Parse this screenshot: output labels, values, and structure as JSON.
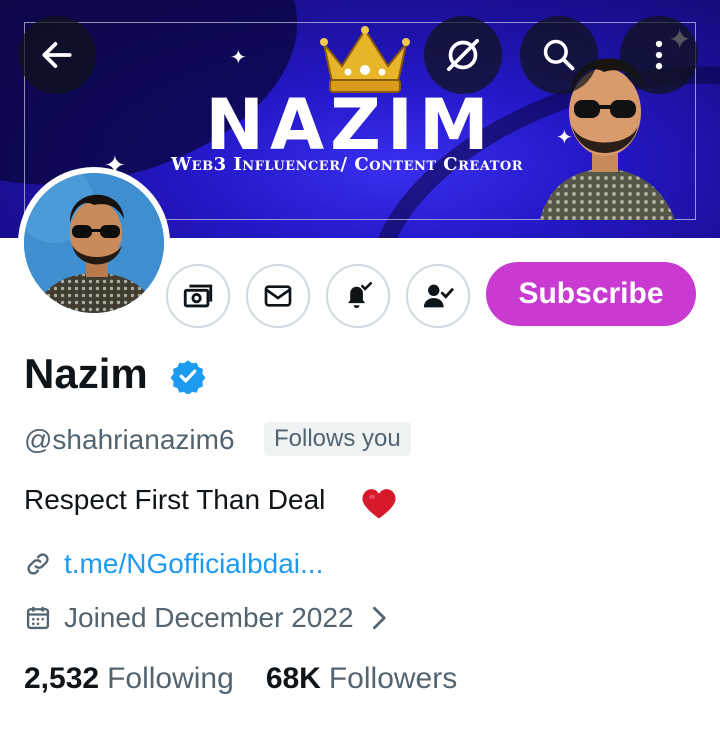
{
  "banner": {
    "title": "NAZIM",
    "subtitle": "Web3 Influencer/ Content Creator"
  },
  "header_buttons": {
    "back_icon": "arrow-left-icon",
    "grok_icon": "grok-icon",
    "search_icon": "search-icon",
    "more_icon": "more-vertical-icon"
  },
  "actions": {
    "icons": [
      "tip-icon",
      "message-icon",
      "notification-bell-icon",
      "following-icon"
    ],
    "subscribe_label": "Subscribe"
  },
  "profile": {
    "name": "Nazim",
    "handle": "@shahrianazim6",
    "follows_you": "Follows you",
    "bio": "Respect First Than Deal",
    "link": "t.me/NGofficialbdai...",
    "joined": "Joined December 2022"
  },
  "stats": {
    "following_count": "2,532",
    "following_label": "Following",
    "followers_count": "68K",
    "followers_label": "Followers"
  },
  "colors": {
    "subscribe": "#c93ad1",
    "link": "#1d9bf0",
    "verified": "#1d9bf0",
    "banner": "#2418c8"
  }
}
